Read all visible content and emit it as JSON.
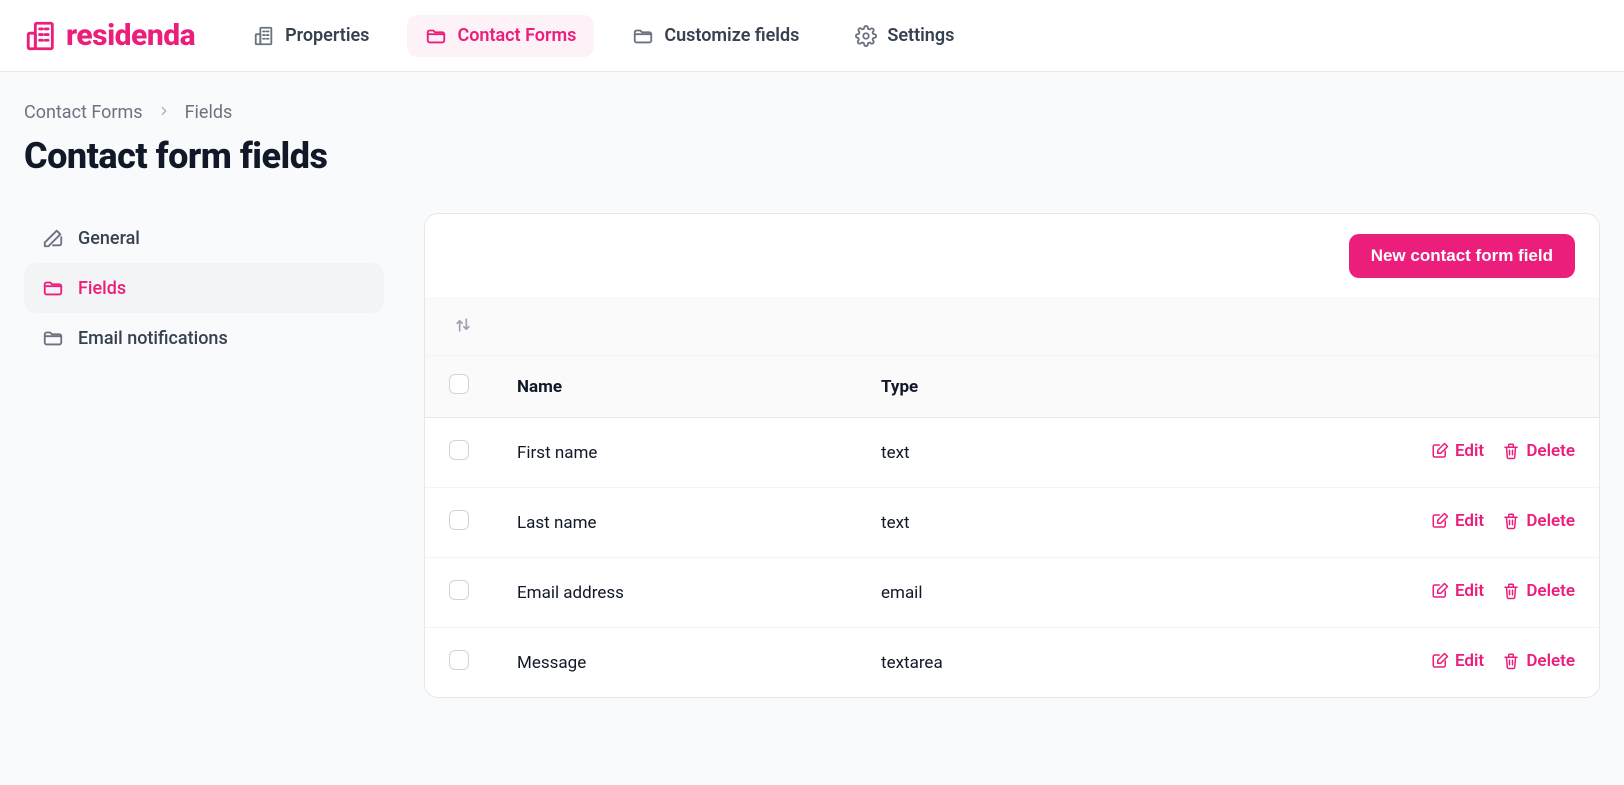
{
  "brand": {
    "name": "residenda"
  },
  "nav": {
    "properties": "Properties",
    "contact_forms": "Contact Forms",
    "customize_fields": "Customize fields",
    "settings": "Settings"
  },
  "breadcrumbs": {
    "parent": "Contact Forms",
    "current": "Fields"
  },
  "page_title": "Contact form fields",
  "sidebar": {
    "general": "General",
    "fields": "Fields",
    "email_notifications": "Email notifications"
  },
  "actions": {
    "new_field": "New contact form field",
    "edit": "Edit",
    "delete": "Delete"
  },
  "table": {
    "columns": {
      "name": "Name",
      "type": "Type"
    },
    "rows": [
      {
        "name": "First name",
        "type": "text"
      },
      {
        "name": "Last name",
        "type": "text"
      },
      {
        "name": "Email address",
        "type": "email"
      },
      {
        "name": "Message",
        "type": "textarea"
      }
    ]
  }
}
